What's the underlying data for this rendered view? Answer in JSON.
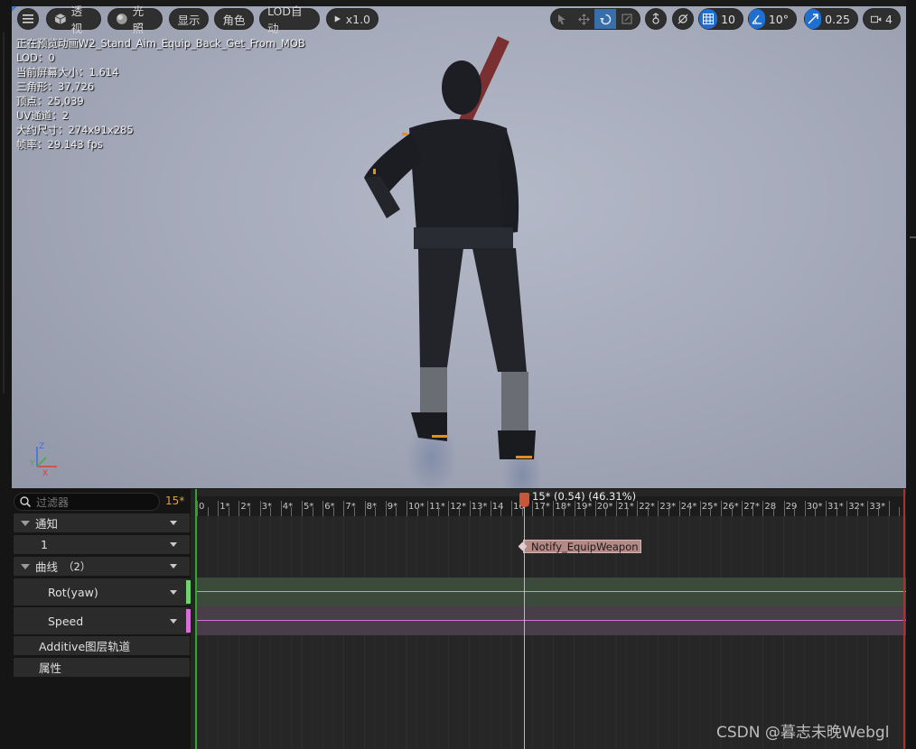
{
  "toolbar": {
    "menu_icon": "hamburger-icon",
    "perspective_label": "透视",
    "lighting_label": "光照",
    "show_label": "显示",
    "character_label": "角色",
    "lod_label": "LOD自动",
    "play_rate_label": "x1.0",
    "grid_value": "10",
    "angle_value": "10°",
    "scale_value": "0.25",
    "camera_value": "4"
  },
  "stats": {
    "line1": "正在预览动画W2_Stand_Aim_Equip_Back_Get_From_MOB",
    "line2": "LOD：0",
    "line3": "当前屏幕大小：1.614",
    "line4": "三角形：37,726",
    "line5": "顶点：25,039",
    "line6": "UV通道：2",
    "line7": "大约尺寸：274x91x285",
    "line8": "帧率：29.143 fps"
  },
  "timeline": {
    "filter_placeholder": "过滤器",
    "current_frame": "15*",
    "playhead_label": "15* (0.54) (46.31%)",
    "ruler_labels": [
      "0",
      "1*",
      "2*",
      "3*",
      "4*",
      "5*",
      "6*",
      "7*",
      "8*",
      "9*",
      "10*",
      "11*",
      "12*",
      "13*",
      "14",
      "16*",
      "17*",
      "18*",
      "19*",
      "20*",
      "21*",
      "22*",
      "23*",
      "24*",
      "25*",
      "26*",
      "27*",
      "28",
      "29",
      "30*",
      "31*",
      "32*",
      "33*"
    ],
    "notify_track_label": "通知",
    "notify_subtrack_label": "1",
    "notify_name": "Notify_EquipWeapon",
    "curves_label": "曲线",
    "curves_count": "（2）",
    "curve1_label": "Rot(yaw)",
    "curve1_color": "#6fd36f",
    "curve2_label": "Speed",
    "curve2_color": "#d66fd6",
    "additive_label": "Additive图层轨道",
    "attributes_label": "属性"
  },
  "watermark": "CSDN @暮志未晚Webgl",
  "colors": {
    "accent": "#1f6fd1",
    "playhead": "#c9553a",
    "frame_number": "#d9a62b"
  }
}
